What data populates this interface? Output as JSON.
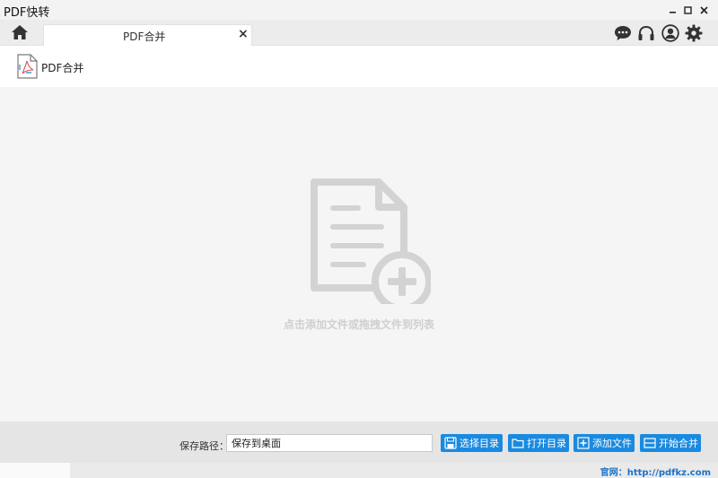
{
  "window": {
    "title": "PDF快转"
  },
  "tabbar": {
    "active_tab": "PDF合并"
  },
  "tool": {
    "title": "PDF合并"
  },
  "droparea": {
    "hint": "点击添加文件或拖拽文件到列表"
  },
  "bottombar": {
    "save_path_label": "保存路径：",
    "save_path_value": "保存到桌面",
    "choose_dir": "选择目录",
    "open_dir": "打开目录",
    "add_file": "添加文件",
    "start_merge": "开始合并"
  },
  "statusbar": {
    "site": "官网：http://pdfkz.com"
  },
  "colors": {
    "accent": "#1a8ae0",
    "link": "#1a73c8",
    "placeholder": "#d3d3d3"
  }
}
